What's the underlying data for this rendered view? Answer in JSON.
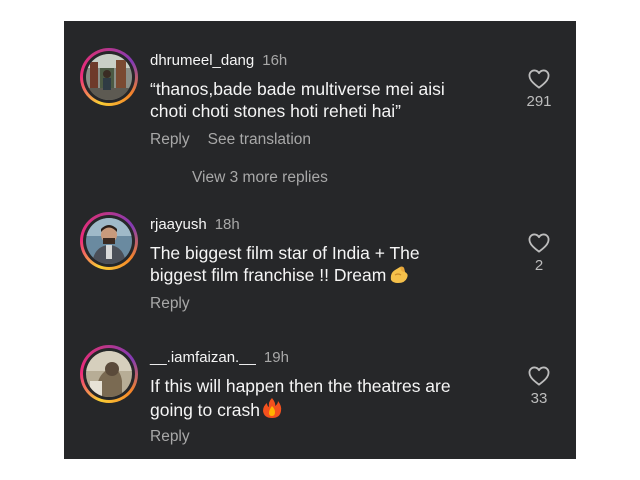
{
  "comments": [
    {
      "username": "dhrumeel_dang",
      "time": "16h",
      "lines": [
        "“thanos,bade bade multiverse mei aisi",
        "choti choti stones hoti reheti hai”"
      ],
      "reply_label": "Reply",
      "translate_label": "See translation",
      "likes": "291",
      "more_replies": "View 3 more replies"
    },
    {
      "username": "rjaayush",
      "time": "18h",
      "lines": [
        "The biggest film star of India + The",
        "biggest film franchise !! Dream"
      ],
      "trailing_emoji": "pinching-hand-emoji",
      "reply_label": "Reply",
      "likes": "2"
    },
    {
      "username": "__.iamfaizan.__",
      "time": "19h",
      "lines": [
        "If this will happen then the theatres are",
        "going to crash"
      ],
      "trailing_emoji": "fire-emoji",
      "reply_label": "Reply",
      "likes": "33"
    }
  ],
  "colors": {
    "background": "#262729",
    "text": "#f5f5f5",
    "muted": "#a8a8a8"
  },
  "icons": {
    "like": "heart-outline-icon"
  }
}
